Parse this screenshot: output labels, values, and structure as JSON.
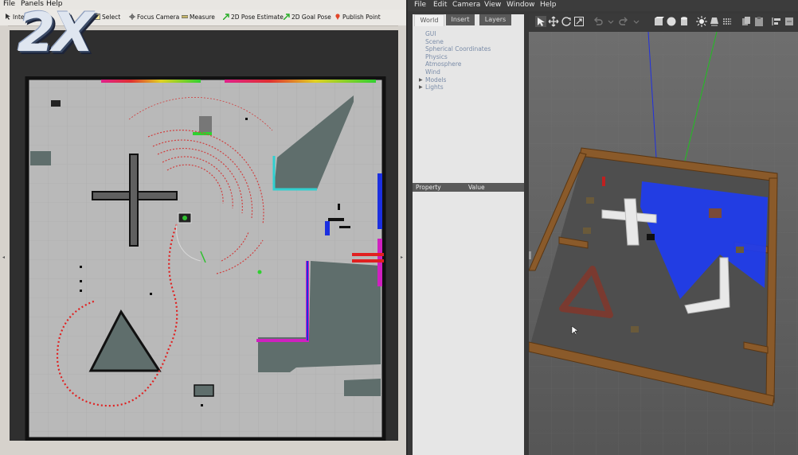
{
  "rviz": {
    "menu": [
      "File",
      "Panels",
      "Help"
    ],
    "toolbar": {
      "interact": "Interact",
      "select": "Select",
      "focus_camera": "Focus Camera",
      "measure": "Measure",
      "pose_estimate": "2D Pose Estimate",
      "goal_pose": "2D Goal Pose",
      "publish_point": "Publish Point"
    },
    "speed_badge": "2X"
  },
  "gazebo": {
    "menu": [
      "File",
      "Edit",
      "Camera",
      "View",
      "Window",
      "Help"
    ],
    "tabs": [
      "World",
      "Insert",
      "Layers"
    ],
    "world_tree": [
      {
        "label": "GUI",
        "expandable": false
      },
      {
        "label": "Scene",
        "expandable": false
      },
      {
        "label": "Spherical Coordinates",
        "expandable": false
      },
      {
        "label": "Physics",
        "expandable": false
      },
      {
        "label": "Atmosphere",
        "expandable": false
      },
      {
        "label": "Wind",
        "expandable": false
      },
      {
        "label": "Models",
        "expandable": true
      },
      {
        "label": "Lights",
        "expandable": true
      }
    ],
    "property_header": {
      "property": "Property",
      "value": "Value"
    }
  },
  "colors": {
    "map_free": "#b7b7b7",
    "map_unknown": "#303030",
    "map_wall": "#000000",
    "inflation": "#5f6e6c",
    "path": "#e02020",
    "laser_blue": "#1b2fe0",
    "wood": "#8a5a2a"
  }
}
